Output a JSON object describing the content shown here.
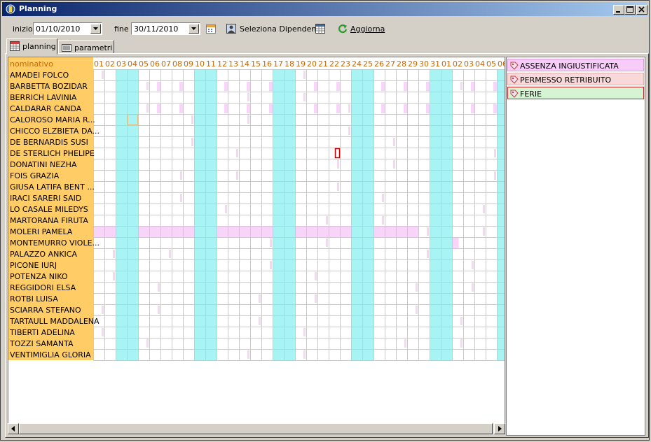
{
  "window": {
    "title": "Planning"
  },
  "toolbar": {
    "start_label": "inizio",
    "start_value": "01/10/2010",
    "end_label": "fine",
    "end_value": "30/11/2010",
    "select_employees_label": "Seleziona Dipendenti",
    "refresh_label": "Aggiorna"
  },
  "tabs": [
    {
      "label": "planning",
      "active": true
    },
    {
      "label": "parametri",
      "active": false
    }
  ],
  "grid": {
    "header_label": "nominativo",
    "days": [
      "01",
      "02",
      "03",
      "04",
      "05",
      "06",
      "07",
      "08",
      "09",
      "10",
      "11",
      "12",
      "13",
      "14",
      "15",
      "16",
      "17",
      "18",
      "19",
      "20",
      "21",
      "22",
      "23",
      "24",
      "25",
      "26",
      "27",
      "28",
      "29",
      "30",
      "31",
      "01",
      "02",
      "03",
      "04",
      "05",
      "06"
    ],
    "weekend_days": [
      2,
      3,
      9,
      10,
      16,
      17,
      23,
      24,
      30,
      31,
      36
    ],
    "employees": [
      "AMADEI FOLCO",
      "BARBETTA BOZIDAR",
      "BERRICH LAVINIA",
      "CALDARAR CANDA",
      "CALOROSO MARIA R...",
      "CHICCO ELZBIETA DA...",
      "DE BERNARDIS SUSI",
      "DE STERLICH PHELIPE",
      "DONATINI NEZHA",
      "FOIS GRAZIA",
      "GIUSA LATIFA BENT ...",
      "IRACI SARERI SAID",
      "LO CASALE MILEDYS",
      "MARTORANA FIRUTA",
      "MOLERI PAMELA",
      "MONTEMURRO VIOLE...",
      "PALAZZO ANKICA",
      "PICONE IURJ",
      "POTENZA NIKO",
      "REGGIDORI ELSA",
      "ROTBI LUISA",
      "SCIARRA STEFANO",
      "TARTAULL MADDALENA",
      "TIBERTI ADELINA",
      "TOZZI SAMANTA",
      "VENTIMIGLIA GLORIA"
    ],
    "absence_color": "#f8d4f8",
    "weekend_color": "#a8f4f4",
    "name_column_color": "#ffcc66",
    "header_text_color": "#cc6600",
    "highlighted_cell_color": "#cc0000",
    "hovered_cell_color": "#e0c080"
  },
  "legend": {
    "items": [
      {
        "label": "ASSENZA INGIUSTIFICATA",
        "bg": "#f8ccf8",
        "border": "#d8a0d8",
        "icon": "tag-icon"
      },
      {
        "label": "PERMESSO RETRIBUITO",
        "bg": "#f8d8d8",
        "border": "#e0b0b0",
        "icon": "tag-icon"
      },
      {
        "label": "FERIE",
        "bg": "#d4f4d4",
        "border": "#cc2020",
        "icon": "tag-icon"
      }
    ]
  }
}
